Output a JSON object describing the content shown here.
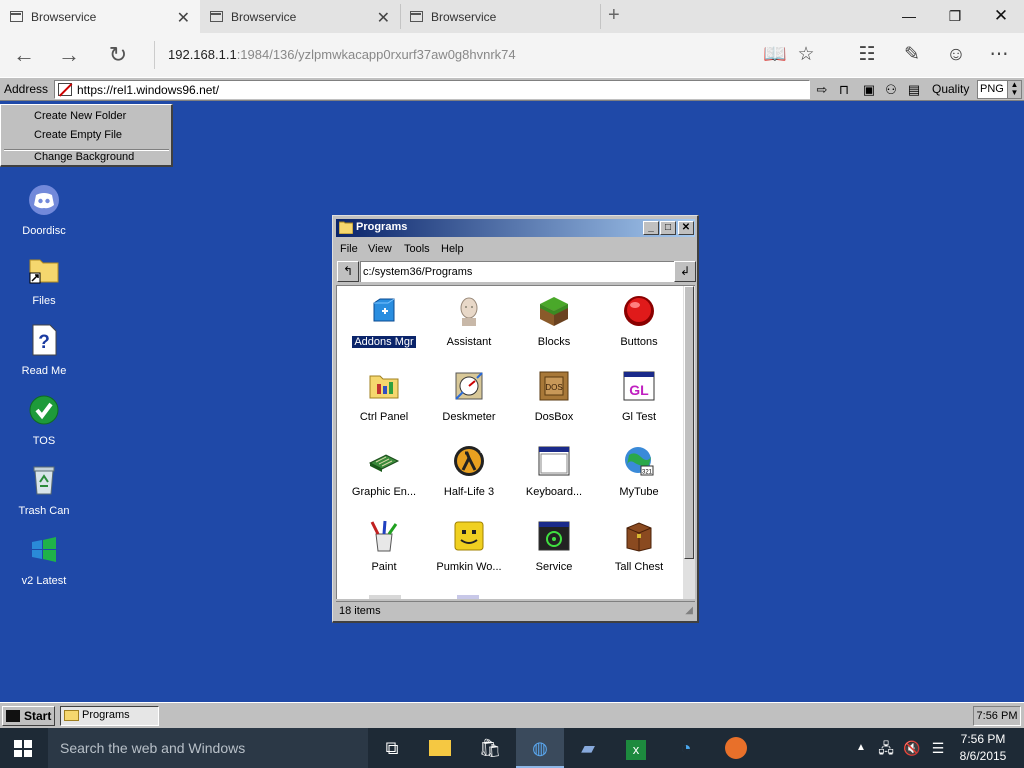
{
  "browser": {
    "tabs": [
      {
        "title": "Browservice"
      },
      {
        "title": "Browservice"
      },
      {
        "title": "Browservice"
      }
    ],
    "url_host": "192.168.1.1",
    "url_rest": ":1984/136/yzlpmwkacapp0rxurf37aw0g8hvnrk74"
  },
  "addressbar": {
    "label": "Address",
    "url": "https://rel1.windows96.net/",
    "quality_label": "Quality",
    "quality_value": "PNG"
  },
  "context_menu": {
    "items": [
      "Create New Folder",
      "Create Empty File",
      "Change Background"
    ]
  },
  "desktop": {
    "icons": [
      {
        "label": "Doordisc",
        "icon": "discord-icon"
      },
      {
        "label": "Files",
        "icon": "folder-shortcut-icon"
      },
      {
        "label": "Read Me",
        "icon": "help-document-icon"
      },
      {
        "label": "TOS",
        "icon": "checkmark-icon"
      },
      {
        "label": "Trash Can",
        "icon": "recycle-bin-icon"
      },
      {
        "label": "v2 Latest",
        "icon": "windows-flag-icon"
      }
    ]
  },
  "explorer": {
    "title": "Programs",
    "menu": [
      "File",
      "View",
      "Tools",
      "Help"
    ],
    "path": "c:/system36/Programs",
    "items": [
      {
        "label": "Addons Mgr",
        "icon": "addons-icon",
        "selected": true
      },
      {
        "label": "Assistant",
        "icon": "assistant-icon"
      },
      {
        "label": "Blocks",
        "icon": "blocks-icon"
      },
      {
        "label": "Buttons",
        "icon": "red-button-icon"
      },
      {
        "label": "Ctrl Panel",
        "icon": "control-panel-icon"
      },
      {
        "label": "Deskmeter",
        "icon": "deskmeter-icon"
      },
      {
        "label": "DosBox",
        "icon": "dosbox-icon"
      },
      {
        "label": "Gl Test",
        "icon": "gl-test-icon"
      },
      {
        "label": "Graphic En...",
        "icon": "graphics-card-icon"
      },
      {
        "label": "Half-Life 3",
        "icon": "half-life-icon"
      },
      {
        "label": "Keyboard...",
        "icon": "keyboard-window-icon"
      },
      {
        "label": "MyTube",
        "icon": "mytube-icon"
      },
      {
        "label": "Paint",
        "icon": "paint-icon"
      },
      {
        "label": "Pumkin Wo...",
        "icon": "pumpkin-icon"
      },
      {
        "label": "Service",
        "icon": "service-biohazard-icon"
      },
      {
        "label": "Tall Chest",
        "icon": "chest-icon"
      }
    ],
    "status": "18 items"
  },
  "taskbar96": {
    "start_label": "Start",
    "task_label": "Programs",
    "clock": "7:56 PM"
  },
  "taskbar10": {
    "search_placeholder": "Search the web and Windows",
    "time": "7:56 PM",
    "date": "8/6/2015"
  },
  "colors": {
    "desktop": "#1f49a8",
    "title_gradient_start": "#0a246a",
    "title_gradient_end": "#a6caf0",
    "win_gray": "#c0c0c0"
  }
}
